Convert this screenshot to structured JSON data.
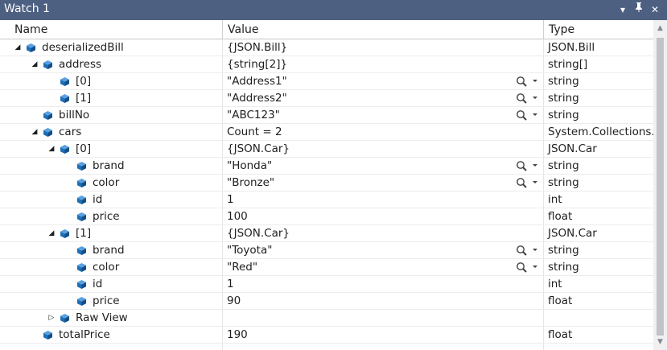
{
  "window": {
    "title": "Watch 1",
    "dropdown_icon": "▾",
    "pin_icon": "📌",
    "close_icon": "✕"
  },
  "columns": {
    "name": "Name",
    "value": "Value",
    "type": "Type"
  },
  "colors": {
    "titlebar": "#4d6082",
    "cube": "#1f6fb5",
    "grid_border": "#ececec"
  },
  "rows": [
    {
      "indent": 0,
      "expander": "expanded",
      "name": "deserializedBill",
      "value": "{JSON.Bill}",
      "type": "JSON.Bill",
      "viz": false
    },
    {
      "indent": 1,
      "expander": "expanded",
      "name": "address",
      "value": "{string[2]}",
      "type": "string[]",
      "viz": false
    },
    {
      "indent": 2,
      "expander": "none",
      "name": "[0]",
      "value": "\"Address1\"",
      "type": "string",
      "viz": true
    },
    {
      "indent": 2,
      "expander": "none",
      "name": "[1]",
      "value": "\"Address2\"",
      "type": "string",
      "viz": true
    },
    {
      "indent": 1,
      "expander": "none",
      "name": "billNo",
      "value": "\"ABC123\"",
      "type": "string",
      "viz": true
    },
    {
      "indent": 1,
      "expander": "expanded",
      "name": "cars",
      "value": "Count = 2",
      "type": "System.Collections.Generic.List<JSON.Car>",
      "viz": false
    },
    {
      "indent": 2,
      "expander": "expanded",
      "name": "[0]",
      "value": "{JSON.Car}",
      "type": "JSON.Car",
      "viz": false
    },
    {
      "indent": 3,
      "expander": "none",
      "name": "brand",
      "value": "\"Honda\"",
      "type": "string",
      "viz": true
    },
    {
      "indent": 3,
      "expander": "none",
      "name": "color",
      "value": "\"Bronze\"",
      "type": "string",
      "viz": true
    },
    {
      "indent": 3,
      "expander": "none",
      "name": "id",
      "value": "1",
      "type": "int",
      "viz": false
    },
    {
      "indent": 3,
      "expander": "none",
      "name": "price",
      "value": "100",
      "type": "float",
      "viz": false
    },
    {
      "indent": 2,
      "expander": "expanded",
      "name": "[1]",
      "value": "{JSON.Car}",
      "type": "JSON.Car",
      "viz": false
    },
    {
      "indent": 3,
      "expander": "none",
      "name": "brand",
      "value": "\"Toyota\"",
      "type": "string",
      "viz": true
    },
    {
      "indent": 3,
      "expander": "none",
      "name": "color",
      "value": "\"Red\"",
      "type": "string",
      "viz": true
    },
    {
      "indent": 3,
      "expander": "none",
      "name": "id",
      "value": "1",
      "type": "int",
      "viz": false
    },
    {
      "indent": 3,
      "expander": "none",
      "name": "price",
      "value": "90",
      "type": "float",
      "viz": false
    },
    {
      "indent": 2,
      "expander": "collapsed",
      "name": "Raw View",
      "value": "",
      "type": "",
      "viz": false
    },
    {
      "indent": 1,
      "expander": "none",
      "name": "totalPrice",
      "value": "190",
      "type": "float",
      "viz": false
    }
  ]
}
